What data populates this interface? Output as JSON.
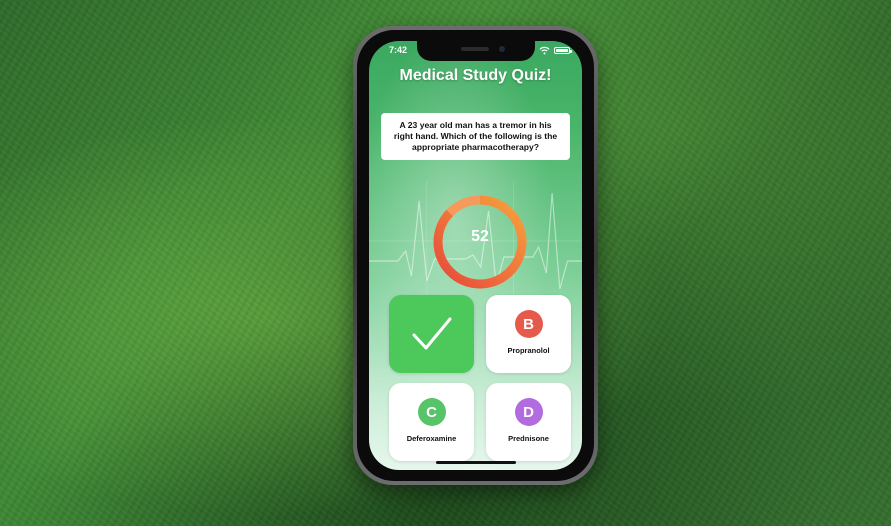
{
  "status_bar": {
    "time": "7:42",
    "icons": [
      "wifi-icon",
      "battery-icon"
    ]
  },
  "app": {
    "title": "Medical Study Quiz!"
  },
  "question": {
    "text": "A 23 year old man has a tremor in his right hand. Which of the following is the appropriate pharmacotherapy?"
  },
  "timer": {
    "value": "52",
    "progress": 0.87,
    "colors": {
      "track": "#f59a5a",
      "start": "#e8483b",
      "end": "#f7a33c"
    }
  },
  "answers": [
    {
      "state": "correct",
      "icon": "check-icon",
      "color": "#4cc95a"
    },
    {
      "letter": "B",
      "label": "Propranolol",
      "color": "#e65a4c"
    },
    {
      "letter": "C",
      "label": "Deferoxamine",
      "color": "#57c46a"
    },
    {
      "letter": "D",
      "label": "Prednisone",
      "color": "#b36be0"
    }
  ]
}
